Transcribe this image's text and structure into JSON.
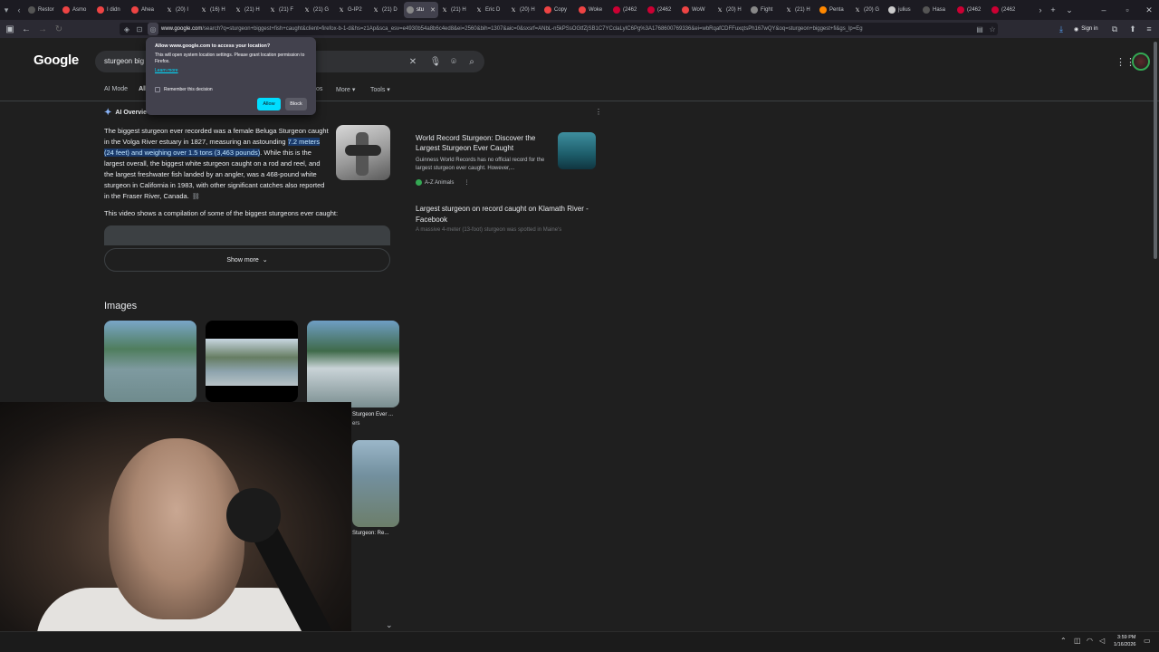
{
  "tabs": [
    {
      "label": "Restor",
      "fav": "#555"
    },
    {
      "label": "Asmo",
      "fav": "#e44"
    },
    {
      "label": "I didn",
      "fav": "#e44"
    },
    {
      "label": "Ahea",
      "fav": "#e44"
    },
    {
      "label": "(20) I",
      "fav": "X"
    },
    {
      "label": "(16) H",
      "fav": "X"
    },
    {
      "label": "(21) H",
      "fav": "X"
    },
    {
      "label": "(21) F",
      "fav": "X"
    },
    {
      "label": "(21) G",
      "fav": "X"
    },
    {
      "label": "G-IP2",
      "fav": "X"
    },
    {
      "label": "(21) D",
      "fav": "X"
    },
    {
      "label": "stu",
      "fav": "#888",
      "active": true
    },
    {
      "label": "(21) H",
      "fav": "X"
    },
    {
      "label": "Eric D",
      "fav": "X"
    },
    {
      "label": "(20) H",
      "fav": "X"
    },
    {
      "label": "Copy",
      "fav": "#e44"
    },
    {
      "label": "Woke",
      "fav": "#e44"
    },
    {
      "label": "(2462",
      "fav": "#c03"
    },
    {
      "label": "(2462",
      "fav": "#c03"
    },
    {
      "label": "WoW",
      "fav": "#e44"
    },
    {
      "label": "(20) H",
      "fav": "X"
    },
    {
      "label": "Fight",
      "fav": "#888"
    },
    {
      "label": "(21) H",
      "fav": "X"
    },
    {
      "label": "Penta",
      "fav": "#f80"
    },
    {
      "label": "(20) G",
      "fav": "X"
    },
    {
      "label": "julius",
      "fav": "#ccc"
    },
    {
      "label": "Hasa",
      "fav": "#555"
    },
    {
      "label": "(2462",
      "fav": "#c03"
    },
    {
      "label": "(2462",
      "fav": "#c03"
    }
  ],
  "url": {
    "host": "www.google.com",
    "path": "/search?q=sturgeon+biggest+fish+caught&client=firefox-b-1-d&hs=z1Ap&sca_esv=e4930b54a8b6c4ed8&ei=2560&bih=1307&aic=0&sxsrf=ANbL-n5kPSsOGtfZjSB1C7YCclaLyIC6Pg%3A1768600769336&ei=wbRqafCDFFuxqtsPh167wQY&oq=sturgeon+biggest+fi&gs_lp=Eg"
  },
  "signin": "Sign in",
  "google": {
    "logo": "Google",
    "query": "sturgeon big",
    "tabs": [
      "AI Mode",
      "All"
    ],
    "tab_partial": "os",
    "more": "More",
    "tools": "Tools"
  },
  "popup": {
    "title": "Allow www.google.com to access your location?",
    "body": "This will open system location settings. Please grant location permission to Firefox.",
    "learn": "Learn more",
    "remember": "Remember this decision",
    "allow": "Allow",
    "block": "Block"
  },
  "ai": {
    "heading": "AI Overvie",
    "p1": "The biggest sturgeon ever recorded was a female Beluga Sturgeon caught in the Volga River estuary in 1827, measuring an astounding ",
    "highlight": "7.2 meters (24 feet) and weighing over 1.5 tons (3,463 pounds)",
    "p2": ". While this is the largest overall, the biggest white sturgeon caught on a rod and reel, and the largest freshwater fish landed by an angler, was a 468-pound white sturgeon in California in 1983, with other significant catches also reported in the Fraser River, Canada.",
    "video_note": "This video shows a compilation of some of the biggest sturgeons ever caught:",
    "show_more": "Show more"
  },
  "sources": [
    {
      "title": "World Record Sturgeon: Discover the Largest Sturgeon Ever Caught",
      "desc": "Guinness World Records has no official record for the largest sturgeon ever caught. However,...",
      "site": "A-Z Animals"
    },
    {
      "title": "Largest sturgeon on record caught on Klamath River - Facebook",
      "desc": "A massive 4-meter (13-foot) sturgeon was spotted in Maine's"
    }
  ],
  "images": {
    "heading": "Images",
    "cap3": "Sturgeon Ever ...",
    "cap3b": "ers",
    "cap4": "Sturgeon: Re..."
  },
  "clock": {
    "time": "3:59 PM",
    "date": "1/16/2026"
  }
}
